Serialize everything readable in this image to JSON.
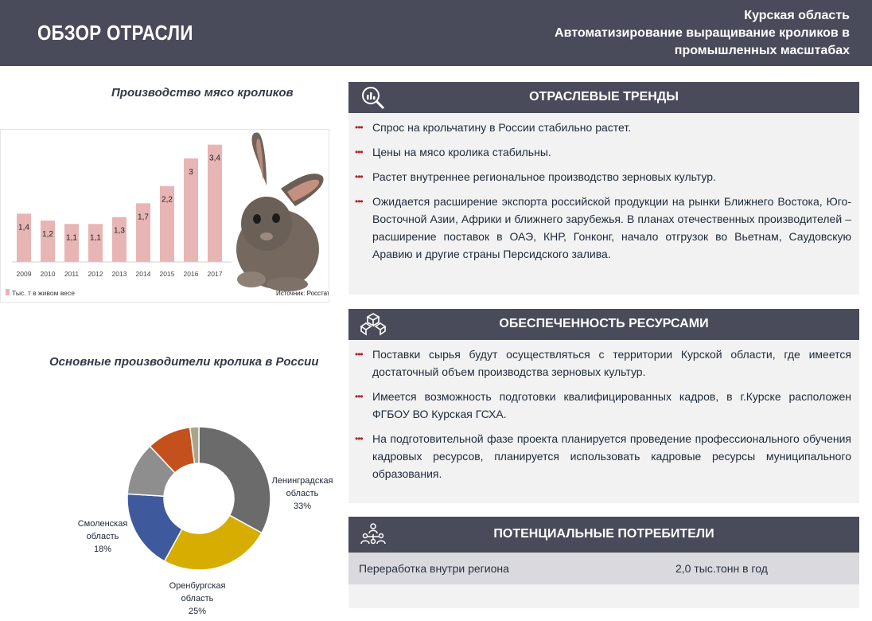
{
  "header": {
    "title": "ОБЗОР ОТРАСЛИ",
    "region": "Курская область",
    "project_line1": "Автоматизирование выращивание кроликов в",
    "project_line2": "промышленных масштабах"
  },
  "chart_data": [
    {
      "type": "bar",
      "title": "Производство мясо кроликов",
      "categories": [
        "2009",
        "2010",
        "2011",
        "2012",
        "2013",
        "2014",
        "2015",
        "2016",
        "2017"
      ],
      "values": [
        1.4,
        1.2,
        1.1,
        1.1,
        1.3,
        1.7,
        2.2,
        3,
        3.4
      ],
      "value_labels": [
        "1,4",
        "1,2",
        "1,1",
        "1,1",
        "1,3",
        "1,7",
        "2,2",
        "3",
        "3,4"
      ],
      "legend": "Тыс. т в живом весе",
      "source": "Источник: Росстат",
      "ylim": [
        0,
        3.6
      ],
      "grid": false,
      "legend_position": "bottom-left",
      "bar_color": "#e8b5b5"
    },
    {
      "type": "pie",
      "title": "Основные производители кролика в России",
      "slices": [
        {
          "name": "Ленинградская область",
          "value": 33,
          "label_lines": [
            "Ленинградская",
            "область",
            "33%"
          ],
          "color": "#6b6b6b"
        },
        {
          "name": "Оренбургская область",
          "value": 25,
          "label_lines": [
            "Оренбургская",
            "область",
            "25%"
          ],
          "color": "#d6ad00"
        },
        {
          "name": "Смоленская область",
          "value": 18,
          "label_lines": [
            "Смоленская",
            "область",
            "18%"
          ],
          "color": "#3f5a9c"
        },
        {
          "name": "",
          "value": 12,
          "color": "#8e8e8e"
        },
        {
          "name": "",
          "value": 10,
          "color": "#c4511d"
        },
        {
          "name": "",
          "value": 2,
          "color": "#a9a58a"
        }
      ]
    }
  ],
  "trends": {
    "title": "ОТРАСЛЕВЫЕ ТРЕНДЫ",
    "icon": "magnifier-chart-icon",
    "bullet_marker": "•••",
    "items": [
      "Спрос на крольчатину в России стабильно  растет.",
      "Цены на мясо кролика  стабильны.",
      "Растет  внутреннее региональное производство  зерновых культур.",
      "Ожидается расширение экспорта российской продукции на рынки Ближнего Востока, Юго-Восточной Азии, Африки и ближнего зарубежья. В планах отечественных производителей – расширение поставок в ОАЭ, КНР, Гонконг, начало отгрузок во Вьетнам, Саудовскую Аравию и другие страны Персидского залива."
    ]
  },
  "resources": {
    "title": "ОБЕСПЕЧЕННОСТЬ РЕСУРСАМИ",
    "icon": "resource-cubes-icon",
    "items": [
      "Поставки сырья будут осуществляться с территории Курской области, где имеется достаточный объем производства зерновых культур.",
      "Имеется возможность подготовки квалифицированных кадров, в г.Курске расположен ФГБОУ ВО Курская ГСХА.",
      " На подготовительной фазе проекта планируется проведение профессионального обучения кадровых ресурсов, планируется использовать кадровые ресурсы муниципального образования."
    ]
  },
  "consumers": {
    "title": "ПОТЕНЦИАЛЬНЫЕ ПОТРЕБИТЕЛИ",
    "icon": "people-network-icon",
    "rows": [
      {
        "name": "Переработка внутри региона",
        "value": "2,0 тыс.тонн в год"
      }
    ]
  }
}
